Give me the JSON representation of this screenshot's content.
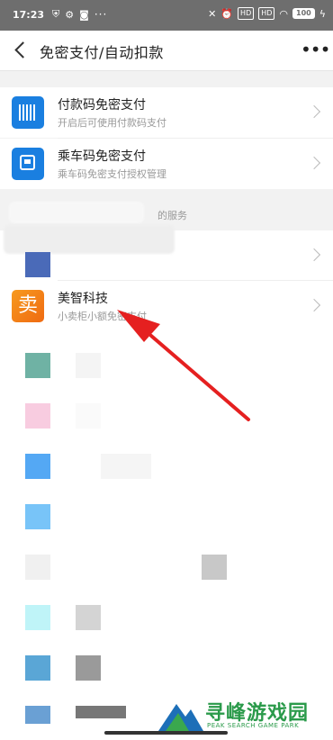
{
  "status_bar": {
    "time": "17:23",
    "more_dots": "···",
    "network_1": "HD",
    "network_2": "HD",
    "battery": "100"
  },
  "nav": {
    "title": "免密支付/自动扣款",
    "more": "•••"
  },
  "items": [
    {
      "title": "付款码免密支付",
      "subtitle": "开启后可使用付款码支付"
    },
    {
      "title": "乘车码免密支付",
      "subtitle": "乘车码免密支付授权管理"
    }
  ],
  "section": {
    "label": "的服务"
  },
  "merchant": {
    "title": "美智科技",
    "subtitle": "小卖柜小额免密支付",
    "icon_char": "卖"
  },
  "watermark": {
    "title": "寻峰游戏园",
    "subtitle": "PEAK SEARCH GAME PARK"
  },
  "colors": {
    "accent_blue": "#1a7fe0",
    "merchant_orange": "#f28a1a",
    "arrow_red": "#e52020"
  }
}
